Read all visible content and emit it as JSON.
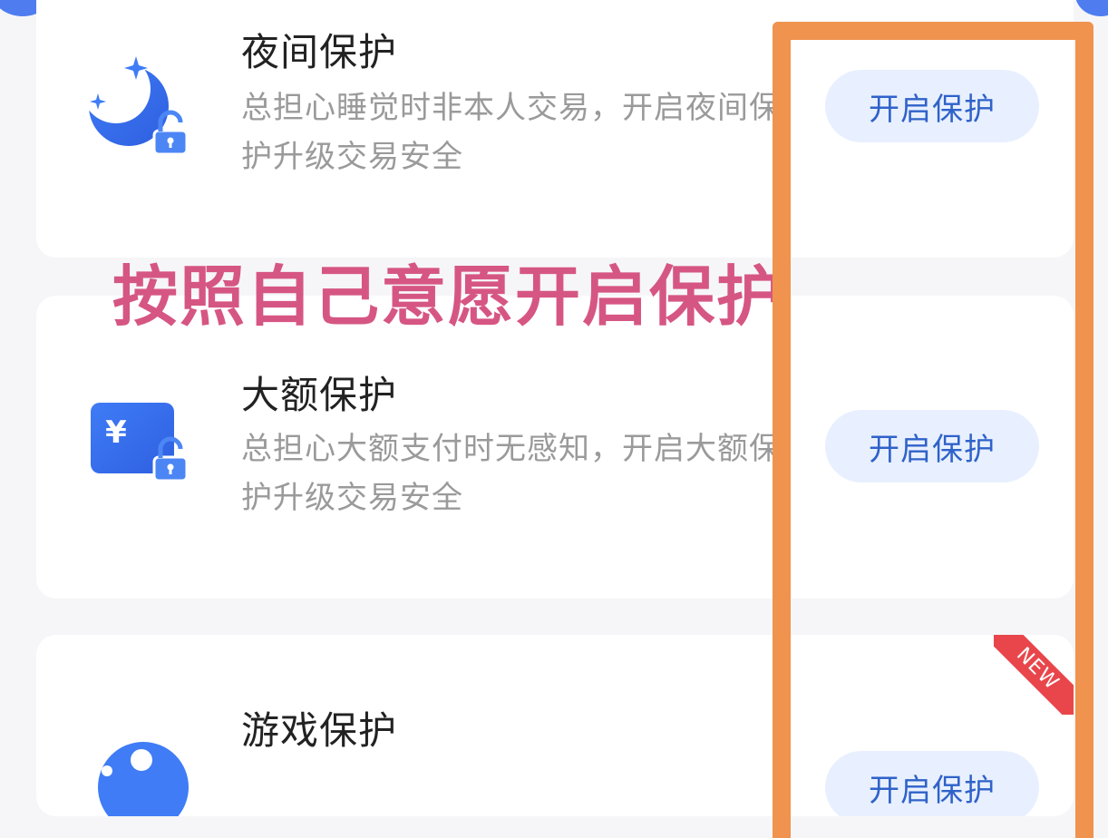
{
  "annotation": {
    "text": "按照自己意愿开启保护",
    "color": "#d65683",
    "highlight_color": "#ef934e"
  },
  "cards": [
    {
      "icon": "moon-lock-icon",
      "title": "夜间保护",
      "description": "总担心睡觉时非本人交易，开启夜间保护升级交易安全",
      "button_label": "开启保护"
    },
    {
      "icon": "yuan-card-lock-icon",
      "title": "大额保护",
      "description": "总担心大额支付时无感知，开启大额保护升级交易安全",
      "button_label": "开启保护"
    },
    {
      "icon": "game-icon",
      "title": "游戏保护",
      "badge": "NEW",
      "button_label": "开启保护"
    }
  ],
  "colors": {
    "accent": "#4f7df0",
    "button_bg": "#e8f0ff",
    "button_text": "#2f62c9",
    "new_badge": "#e8464b"
  }
}
